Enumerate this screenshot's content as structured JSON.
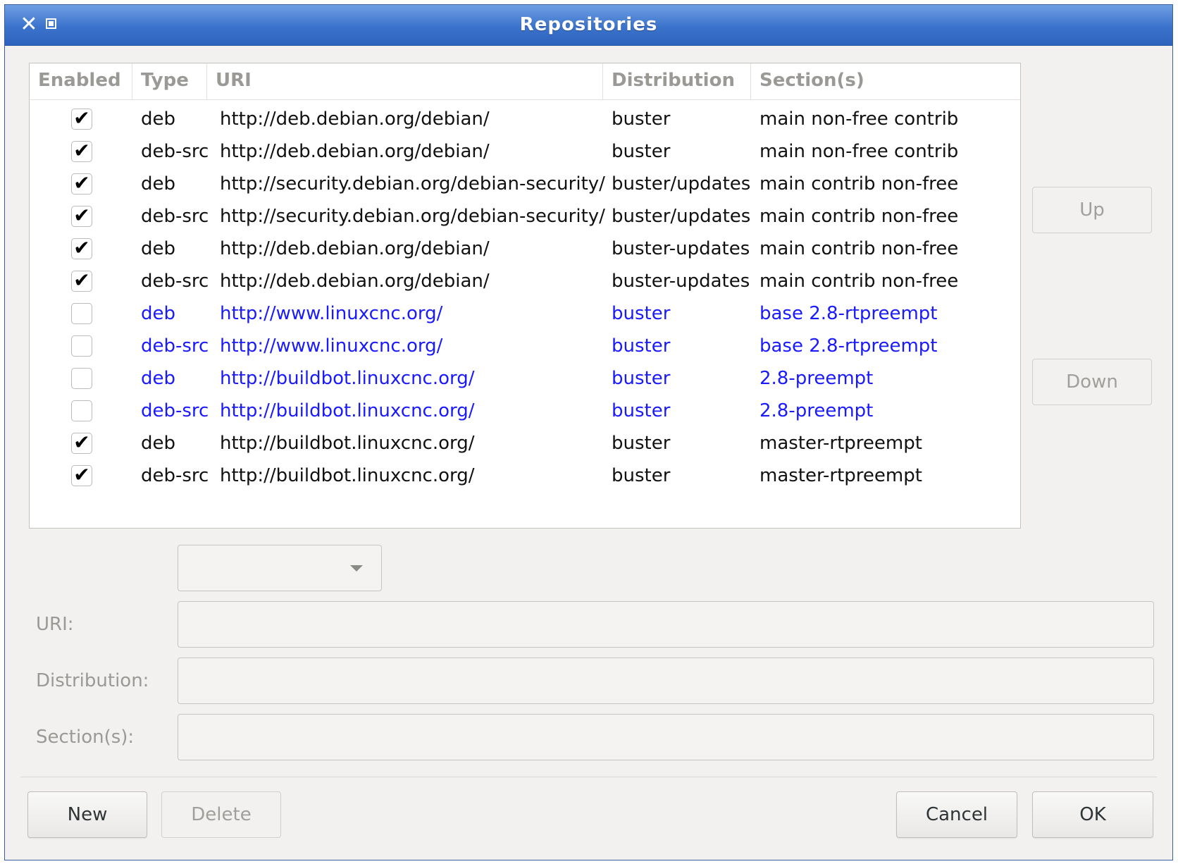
{
  "window": {
    "title": "Repositories"
  },
  "list": {
    "columns": [
      "Enabled",
      "Type",
      "URI",
      "Distribution",
      "Section(s)"
    ],
    "rows": [
      {
        "enabled": true,
        "type": "deb",
        "uri": "http://deb.debian.org/debian/",
        "dist": "buster",
        "sections": "main non-free contrib"
      },
      {
        "enabled": true,
        "type": "deb-src",
        "uri": "http://deb.debian.org/debian/",
        "dist": "buster",
        "sections": "main non-free contrib"
      },
      {
        "enabled": true,
        "type": "deb",
        "uri": "http://security.debian.org/debian-security/",
        "dist": "buster/updates",
        "sections": "main contrib non-free"
      },
      {
        "enabled": true,
        "type": "deb-src",
        "uri": "http://security.debian.org/debian-security/",
        "dist": "buster/updates",
        "sections": "main contrib non-free"
      },
      {
        "enabled": true,
        "type": "deb",
        "uri": "http://deb.debian.org/debian/",
        "dist": "buster-updates",
        "sections": "main contrib non-free"
      },
      {
        "enabled": true,
        "type": "deb-src",
        "uri": "http://deb.debian.org/debian/",
        "dist": "buster-updates",
        "sections": "main contrib non-free"
      },
      {
        "enabled": false,
        "type": "deb",
        "uri": "http://www.linuxcnc.org/",
        "dist": "buster",
        "sections": "base 2.8-rtpreempt"
      },
      {
        "enabled": false,
        "type": "deb-src",
        "uri": "http://www.linuxcnc.org/",
        "dist": "buster",
        "sections": "base 2.8-rtpreempt"
      },
      {
        "enabled": false,
        "type": "deb",
        "uri": "http://buildbot.linuxcnc.org/",
        "dist": "buster",
        "sections": "2.8-preempt"
      },
      {
        "enabled": false,
        "type": "deb-src",
        "uri": "http://buildbot.linuxcnc.org/",
        "dist": "buster",
        "sections": "2.8-preempt"
      },
      {
        "enabled": true,
        "type": "deb",
        "uri": "http://buildbot.linuxcnc.org/",
        "dist": "buster",
        "sections": "master-rtpreempt"
      },
      {
        "enabled": true,
        "type": "deb-src",
        "uri": "http://buildbot.linuxcnc.org/",
        "dist": "buster",
        "sections": "master-rtpreempt"
      }
    ]
  },
  "buttons": {
    "up": "Up",
    "down": "Down",
    "new": "New",
    "delete": "Delete",
    "cancel": "Cancel",
    "ok": "OK"
  },
  "form": {
    "type_value": "",
    "uri_label": "URI:",
    "uri_value": "",
    "dist_label": "Distribution:",
    "dist_value": "",
    "sections_label": "Section(s):",
    "sections_value": ""
  },
  "icons": {
    "check": "✔",
    "close": "✕"
  },
  "colors": {
    "titlebar": "#3b73cc",
    "disabled_row_text": "#1a1aff"
  }
}
